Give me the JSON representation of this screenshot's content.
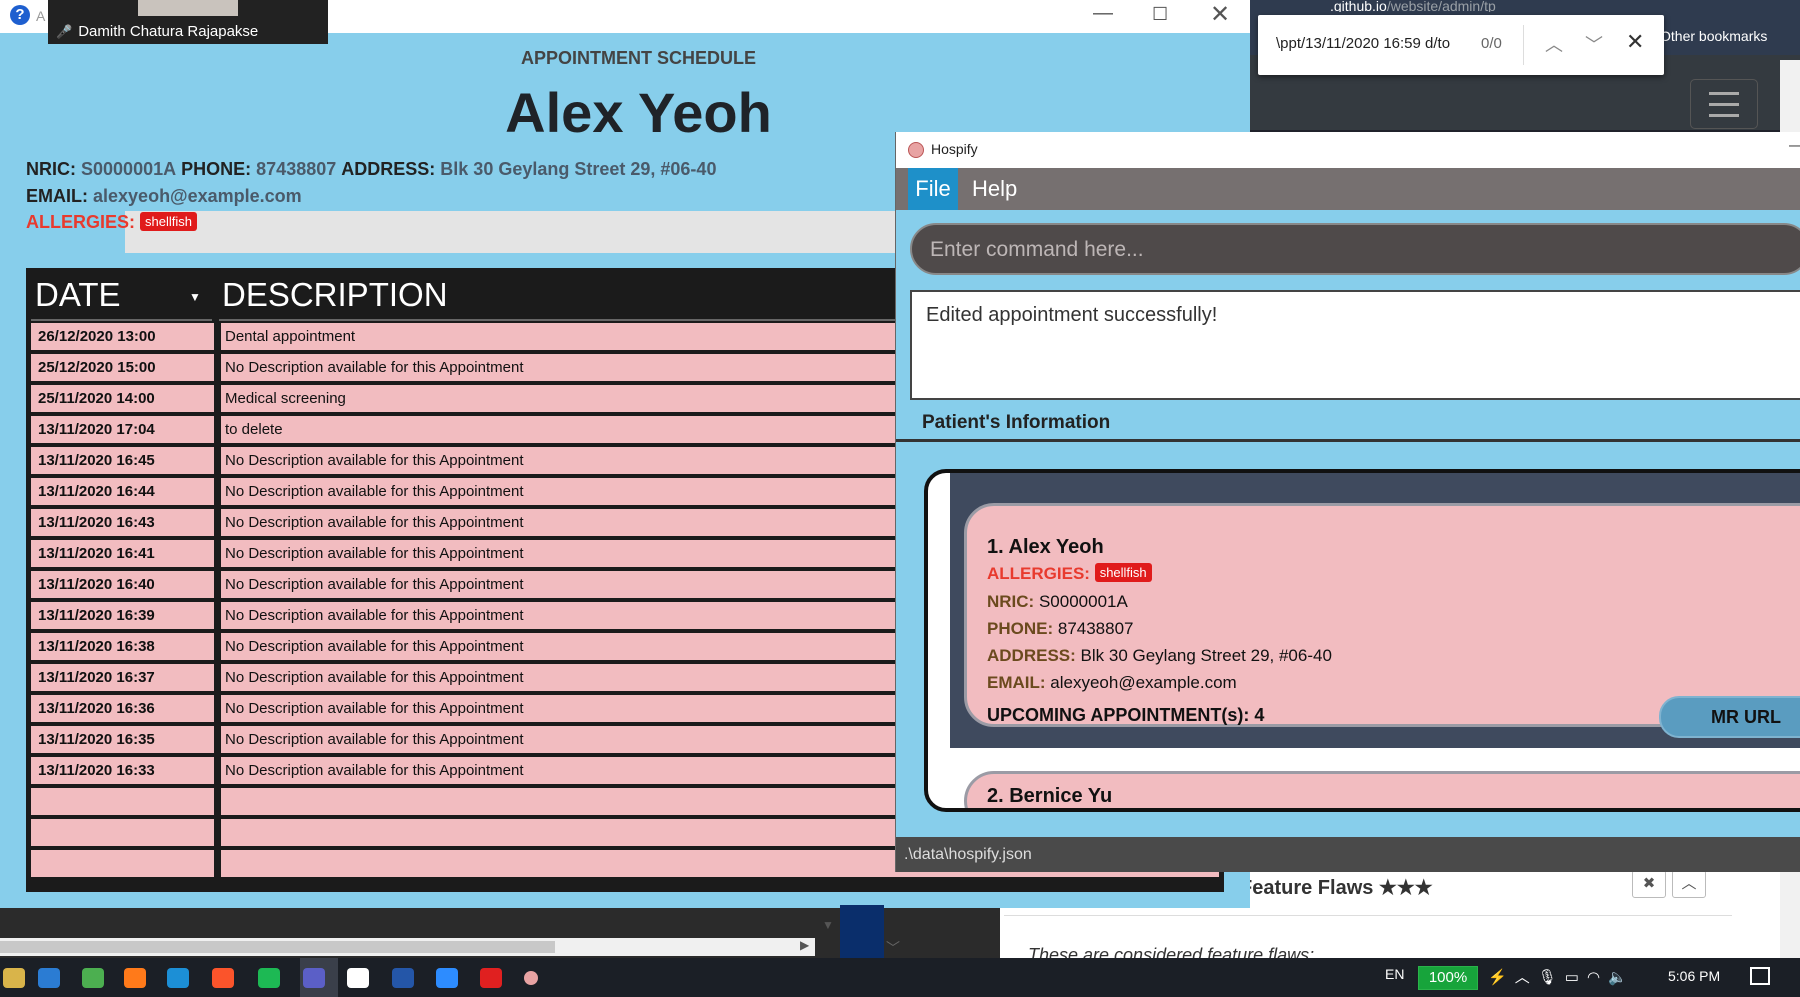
{
  "browser": {
    "url_prefix": "",
    "url_highlight": ".github.io",
    "url_suffix": "/website/admin/tp",
    "bookmarks_label": "Other bookmarks",
    "find_query": "\\ppt/13/11/2020 16:59 d/to",
    "find_count": "0/0",
    "panel_heading": "Feature Flaws ★★★",
    "panel_text": "These are considered feature flaws:"
  },
  "video_call": {
    "participant_name": "Damith Chatura Rajapakse"
  },
  "appointment_window": {
    "title": "A",
    "heading": "APPOINTMENT SCHEDULE",
    "patient_name": "Alex Yeoh",
    "nric_label": "NRIC:",
    "nric": "S0000001A",
    "phone_label": "PHONE:",
    "phone": "87438807",
    "address_label": "ADDRESS:",
    "address": "Blk 30 Geylang Street 29, #06-40",
    "email_label": "EMAIL:",
    "email": "alexyeoh@example.com",
    "allergies_label": "ALLERGIES:",
    "allergy_tag": "shellfish",
    "columns": {
      "date": "DATE",
      "description": "DESCRIPTION"
    },
    "rows": [
      {
        "date": "26/12/2020 13:00",
        "description": "Dental appointment"
      },
      {
        "date": "25/12/2020 15:00",
        "description": "No Description available for this Appointment"
      },
      {
        "date": "25/11/2020 14:00",
        "description": "Medical screening"
      },
      {
        "date": "13/11/2020 17:04",
        "description": "to delete"
      },
      {
        "date": "13/11/2020 16:45",
        "description": "No Description available for this Appointment"
      },
      {
        "date": "13/11/2020 16:44",
        "description": "No Description available for this Appointment"
      },
      {
        "date": "13/11/2020 16:43",
        "description": "No Description available for this Appointment"
      },
      {
        "date": "13/11/2020 16:41",
        "description": "No Description available for this Appointment"
      },
      {
        "date": "13/11/2020 16:40",
        "description": "No Description available for this Appointment"
      },
      {
        "date": "13/11/2020 16:39",
        "description": "No Description available for this Appointment"
      },
      {
        "date": "13/11/2020 16:38",
        "description": "No Description available for this Appointment"
      },
      {
        "date": "13/11/2020 16:37",
        "description": "No Description available for this Appointment"
      },
      {
        "date": "13/11/2020 16:36",
        "description": "No Description available for this Appointment"
      },
      {
        "date": "13/11/2020 16:35",
        "description": "No Description available for this Appointment"
      },
      {
        "date": "13/11/2020 16:33",
        "description": "No Description available for this Appointment"
      },
      {
        "date": "",
        "description": ""
      },
      {
        "date": "",
        "description": ""
      },
      {
        "date": "",
        "description": ""
      }
    ]
  },
  "hospify": {
    "title": "Hospify",
    "menu": {
      "file": "File",
      "help": "Help"
    },
    "command_placeholder": "Enter command here...",
    "result_text": "Edited appointment successfully!",
    "section_heading": "Patient's Information",
    "patients": [
      {
        "index_name": "1.  Alex Yeoh",
        "allergies_label": "ALLERGIES:",
        "allergy_tag": "shellfish",
        "nric_label": "NRIC:",
        "nric": "S0000001A",
        "phone_label": "PHONE:",
        "phone": "87438807",
        "address_label": "ADDRESS:",
        "address": "Blk 30 Geylang Street 29, #06-40",
        "email_label": "EMAIL:",
        "email": "alexyeoh@example.com",
        "upcoming": "UPCOMING APPOINTMENT(s): 4",
        "mr_button": "MR URL"
      },
      {
        "index_name": "2.  Bernice Yu"
      }
    ],
    "status_path": ".\\data\\hospify.json"
  },
  "taskbar": {
    "language": "EN",
    "battery": "100%",
    "time": "5:06 PM",
    "icons": [
      "windows-explorer-icon",
      "mail-icon",
      "chrome-icon",
      "firefox-icon",
      "edge-icon",
      "brave-icon",
      "spotify-icon",
      "teams-icon",
      "email-client-icon",
      "powershell-icon",
      "zoom-icon",
      "acrobat-icon",
      "java-app-icon"
    ]
  },
  "colors": {
    "appt_bg": "#87ceeb",
    "row_pink": "#f2bcc0",
    "allergy_red": "#e83a2e",
    "menu_active": "#1e90c9"
  }
}
